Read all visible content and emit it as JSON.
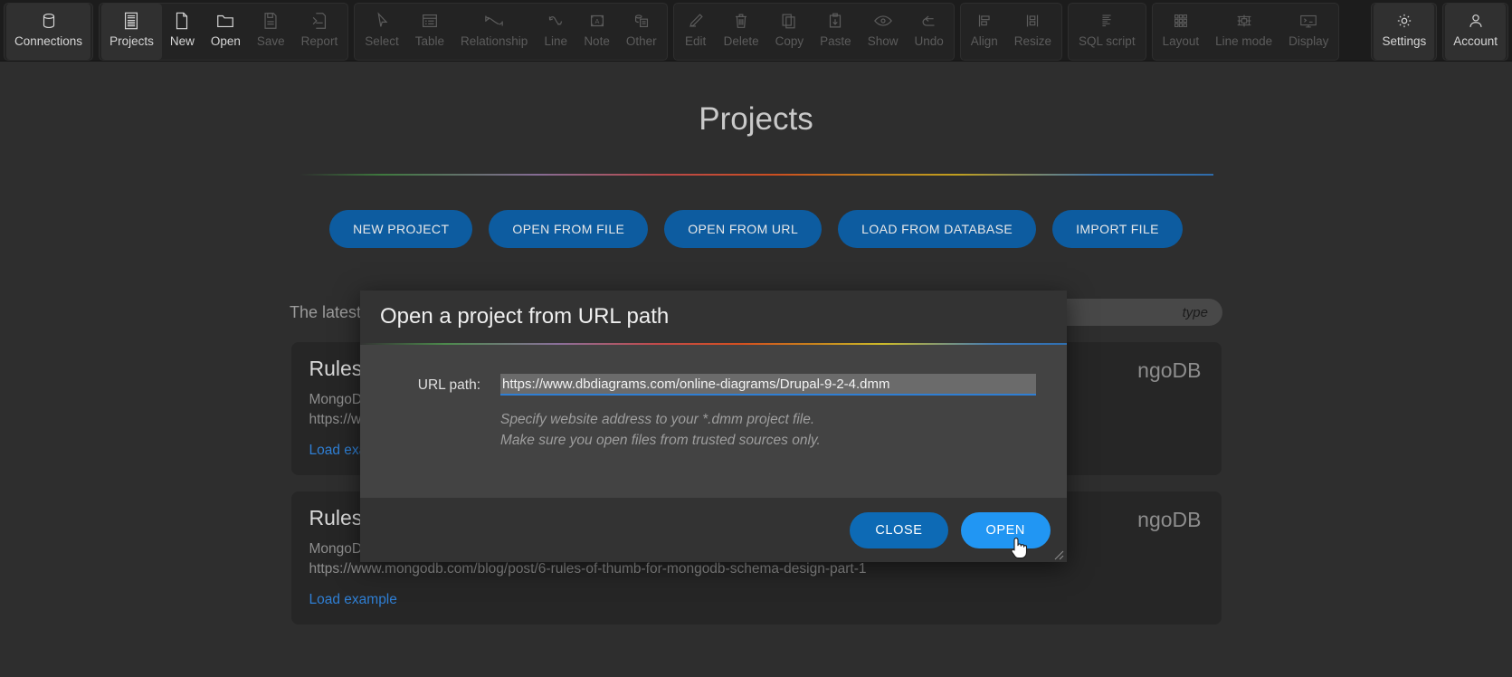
{
  "toolbar": {
    "groups": [
      {
        "name": "connections",
        "items": [
          {
            "label": "Connections",
            "icon": "database-icon",
            "state": "active"
          }
        ]
      },
      {
        "name": "file",
        "items": [
          {
            "label": "Projects",
            "icon": "projects-icon",
            "state": "active"
          },
          {
            "label": "New",
            "icon": "new-file-icon",
            "state": "enabled"
          },
          {
            "label": "Open",
            "icon": "folder-open-icon",
            "state": "enabled"
          },
          {
            "label": "Save",
            "icon": "save-icon",
            "state": "disabled"
          },
          {
            "label": "Report",
            "icon": "report-icon",
            "state": "disabled"
          }
        ]
      },
      {
        "name": "tools",
        "items": [
          {
            "label": "Select",
            "icon": "cursor-arrow-icon",
            "state": "disabled"
          },
          {
            "label": "Table",
            "icon": "table-icon",
            "state": "disabled"
          },
          {
            "label": "Relationship",
            "icon": "relationship-icon",
            "state": "disabled"
          },
          {
            "label": "Line",
            "icon": "line-icon",
            "state": "disabled"
          },
          {
            "label": "Note",
            "icon": "note-icon",
            "state": "disabled"
          },
          {
            "label": "Other",
            "icon": "other-shapes-icon",
            "state": "disabled"
          }
        ]
      },
      {
        "name": "edit",
        "items": [
          {
            "label": "Edit",
            "icon": "pencil-icon",
            "state": "disabled"
          },
          {
            "label": "Delete",
            "icon": "trash-icon",
            "state": "disabled"
          },
          {
            "label": "Copy",
            "icon": "copy-icon",
            "state": "disabled"
          },
          {
            "label": "Paste",
            "icon": "paste-icon",
            "state": "disabled"
          },
          {
            "label": "Show",
            "icon": "eye-icon",
            "state": "disabled"
          },
          {
            "label": "Undo",
            "icon": "undo-arrow-icon",
            "state": "disabled"
          }
        ]
      },
      {
        "name": "arrange",
        "items": [
          {
            "label": "Align",
            "icon": "align-icon",
            "state": "disabled"
          },
          {
            "label": "Resize",
            "icon": "resize-icon",
            "state": "disabled"
          }
        ]
      },
      {
        "name": "script",
        "items": [
          {
            "label": "SQL script",
            "icon": "sql-script-icon",
            "state": "disabled"
          }
        ]
      },
      {
        "name": "view",
        "items": [
          {
            "label": "Layout",
            "icon": "layout-grid-icon",
            "state": "disabled"
          },
          {
            "label": "Line mode",
            "icon": "line-mode-icon",
            "state": "disabled"
          },
          {
            "label": "Display",
            "icon": "display-monitor-icon",
            "state": "disabled"
          }
        ]
      },
      {
        "name": "settings",
        "items": [
          {
            "label": "Settings",
            "icon": "gear-icon",
            "state": "enabled"
          }
        ]
      },
      {
        "name": "account",
        "items": [
          {
            "label": "Account",
            "icon": "person-icon",
            "state": "enabled"
          }
        ]
      }
    ]
  },
  "page": {
    "title": "Projects",
    "actions": [
      "NEW PROJECT",
      "OPEN FROM FILE",
      "OPEN FROM URL",
      "LOAD FROM DATABASE",
      "IMPORT FILE"
    ],
    "latest_label": "The latest",
    "filter_placeholder": "type",
    "cards": [
      {
        "title": "Rules of t",
        "desc_line1": "MongoDB p",
        "desc_line2": "https://www",
        "link": "Load exam",
        "badge": "ngoDB"
      },
      {
        "title": "Rules of t",
        "desc_line1": "MongoDB project based on article published at",
        "desc_line2": "https://www.mongodb.com/blog/post/6-rules-of-thumb-for-mongodb-schema-design-part-1",
        "link": "Load example",
        "badge": "ngoDB"
      }
    ]
  },
  "modal": {
    "title": "Open a project from URL path",
    "url_label": "URL path:",
    "url_value": "https://www.dbdiagrams.com/online-diagrams/Drupal-9-2-4.dmm",
    "url_placeholder": "https://",
    "hint_line1": "Specify website address to your *.dmm project file.",
    "hint_line2": "Make sure you open files from trusted sources only.",
    "close_label": "CLOSE",
    "open_label": "OPEN"
  },
  "colors": {
    "accent_blue": "#0d6ab5",
    "hover_blue": "#2196f3",
    "link_blue": "#2f7fd4",
    "window_bg": "#2e2e2e",
    "toolbar_bg": "#1c1c1c",
    "modal_bg": "#434343",
    "modal_chrome": "#333333"
  }
}
